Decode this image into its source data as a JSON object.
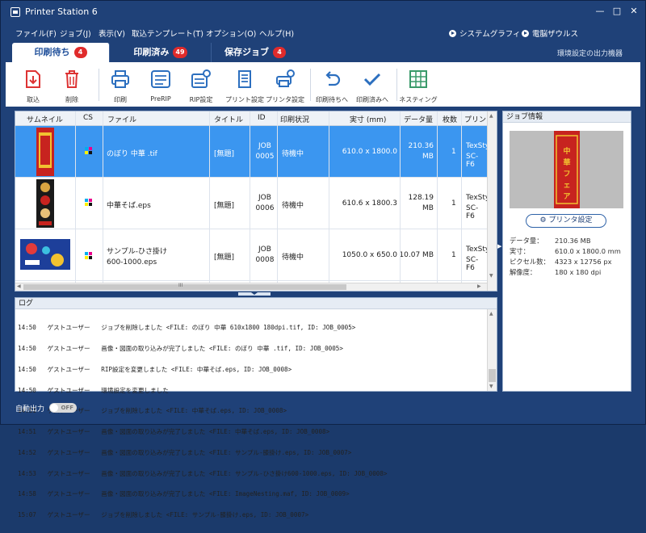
{
  "window": {
    "title": "Printer Station 6",
    "minimize": "—",
    "maximize": "□",
    "close": "✕"
  },
  "menu": {
    "items": [
      "ファイル(F)",
      "ジョブ(J)",
      "表示(V)",
      "取込テンプレート(T)",
      "オプション(O)",
      "ヘルプ(H)"
    ],
    "right": [
      "システムグラフィ",
      "電脳ザウルス"
    ]
  },
  "tabs": [
    {
      "label": "印刷待ち",
      "count": "4"
    },
    {
      "label": "印刷済み",
      "count": "49"
    },
    {
      "label": "保存ジョブ",
      "count": "4"
    }
  ],
  "output_setting": "環境設定の出力機器",
  "toolbar": {
    "import": "取込",
    "delete": "削除",
    "print": "印刷",
    "prerip": "PreRIP",
    "rip_setting": "RIP設定",
    "print_setting": "プリント設定",
    "printer_setting": "プリンタ設定",
    "to_waiting": "印刷待ちへ",
    "to_printed": "印刷済みへ",
    "nesting": "ネスティング"
  },
  "jobs": {
    "headers": [
      "サムネイル",
      "CS",
      "ファイル",
      "タイトル",
      "ID",
      "印刷状況",
      "実寸 (mm)",
      "データ量",
      "枚数",
      "プリン"
    ],
    "rows": [
      {
        "file": "のぼり 中華 .tif",
        "title": "[無題]",
        "id1": "JOB",
        "id2": "0005",
        "status": "待機中",
        "size": "610.0 x 1800.0",
        "data1": "210.36",
        "data2": "MB",
        "count": "1",
        "printer1": "TexSty",
        "printer2": "SC-F6"
      },
      {
        "file": "中華そば.eps",
        "title": "[無題]",
        "id1": "JOB",
        "id2": "0006",
        "status": "待機中",
        "size": "610.6 x 1800.3",
        "data1": "128.19",
        "data2": "MB",
        "count": "1",
        "printer1": "TexSty",
        "printer2": "SC-F6"
      },
      {
        "file1": "サンプル-ひさ掛け",
        "file2": "600-1000.eps",
        "title": "[無題]",
        "id1": "JOB",
        "id2": "0008",
        "status": "待機中",
        "size": "1050.0 x 650.0",
        "data1": "10.07 MB",
        "count": "1",
        "printer1": "TexSty",
        "printer2": "SC-F6"
      }
    ],
    "scroll_grip": "III"
  },
  "log": {
    "title": "ログ",
    "lines": [
      "14:50   ゲストユーザー   ジョブを削除しました <FILE: のぼり 中華 610x1800 180dpi.tif, ID: JOB_0005>",
      "14:50   ゲストユーザー   画像・図面の取り込みが完了しました <FILE: のぼり 中華 .tif, ID: JOB_0005>",
      "14:50   ゲストユーザー   RIP設定を変更しました <FILE: 中華そば.eps, ID: JOB_0008>",
      "14:50   ゲストユーザー   環境設定を変更しました",
      "14:51   ゲストユーザー   ジョブを削除しました <FILE: 中華そば.eps, ID: JOB_0008>",
      "14:51   ゲストユーザー   画像・図面の取り込みが完了しました <FILE: 中華そば.eps, ID: JOB_0008>",
      "14:52   ゲストユーザー   画像・図面の取り込みが完了しました <FILE: サンプル-膝掛け.eps, ID: JOB_0007>",
      "14:53   ゲストユーザー   画像・図面の取り込みが完了しました <FILE: サンプル-ひさ掛け600-1000.eps, ID: JOB_0008>",
      "14:58   ゲストユーザー   画像・図面の取り込みが完了しました <FILE: ImageNesting.maf, ID: JOB_0009>",
      "15:07   ゲストユーザー   ジョブを削除しました <FILE: サンプル-膝掛け.eps, ID: JOB_0007>"
    ]
  },
  "info": {
    "title": "ジョブ情報",
    "printer_button": "プリンタ設定",
    "data_size_label": "データ量：",
    "data_size": "210.36 MB",
    "actual_label": "実寸：",
    "actual": "610.0 x 1800.0 mm",
    "pixels_label": "ピクセル数：",
    "pixels": "4323 x 12756 px",
    "resolution_label": "解像度：",
    "resolution": "180 x 180 dpi"
  },
  "thumbnail": {
    "banner_text": "中華フェア"
  },
  "status": {
    "auto_output_label": "自動出力",
    "auto_output_state": "OFF"
  },
  "colors": {
    "accent": "#1f4178",
    "selected_row": "#3b96f0",
    "badge": "#e02b2b"
  }
}
